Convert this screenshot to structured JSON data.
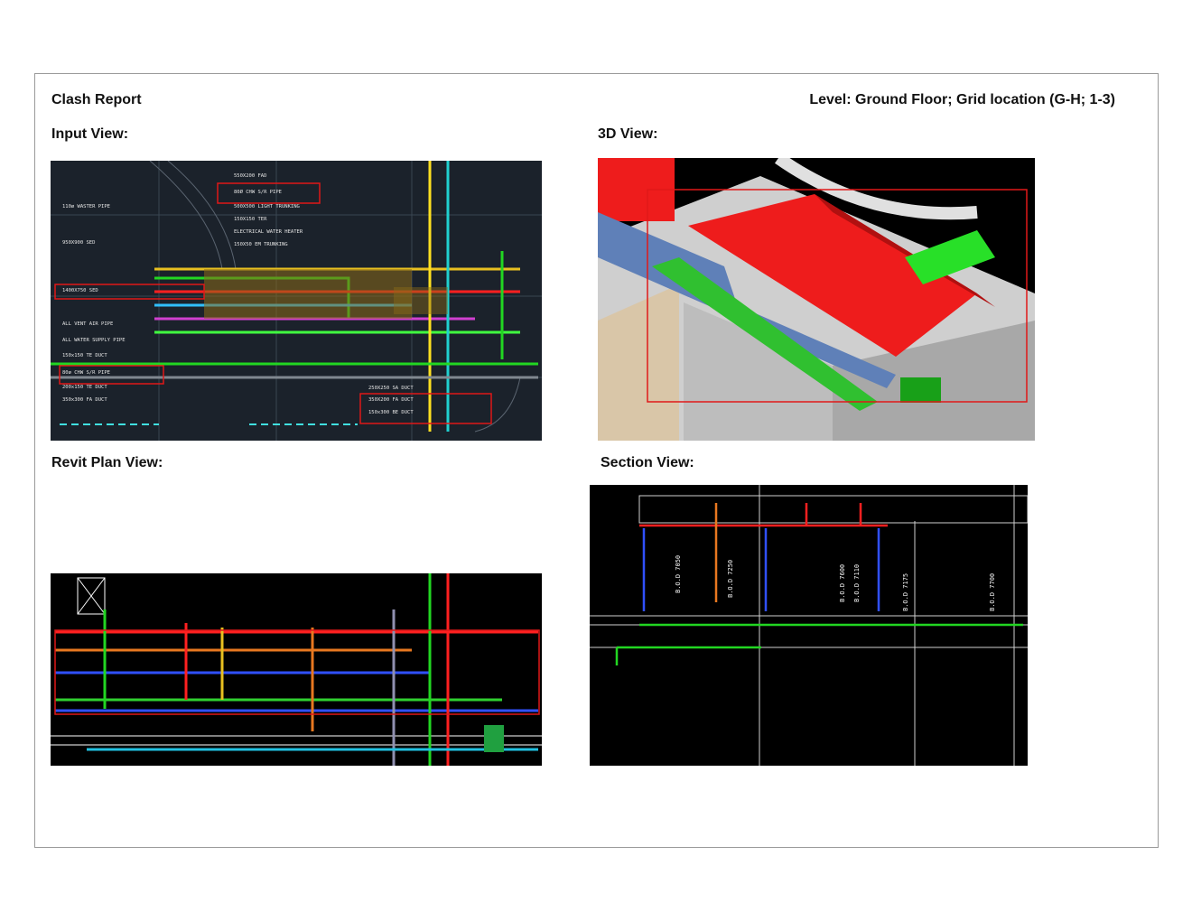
{
  "report": {
    "title": "Clash Report",
    "location": "Level: Ground Floor; Grid location (G-H; 1-3)"
  },
  "views": {
    "input": {
      "label": "Input View:",
      "annotations": [
        "550X200 FAD",
        "80Ø CHW S/R PIPE",
        "500X500 LIGHT TRUNKING",
        "150X150 TER",
        "ELECTRICAL WATER HEATER",
        "150X50 EM TRUNKING",
        "110ø WASTER PIPE",
        "950X900 SED",
        "1400X750 SED",
        "ALL VENT AIR PIPE",
        "ALL WATER SUPPLY PIPE",
        "150x150 TE DUCT",
        "80ø CHW S/R PIPE",
        "200x150 TE DUCT",
        "350x300 FA DUCT",
        "350X200 FA DUCT",
        "150x300 BE DUCT",
        "250X250 SA DUCT"
      ]
    },
    "three_d": {
      "label": "3D View:"
    },
    "revit_plan": {
      "label": "Revit Plan View:"
    },
    "section": {
      "label": "Section View:",
      "levels": [
        "B.O.D 7050",
        "B.O.D 7250",
        "B.O.D 7600",
        "B.O.D 7110",
        "B.O.D 7175",
        "B.O.D 7700"
      ]
    }
  },
  "colors": {
    "cad_background": "#1b222b",
    "section_background": "#000000",
    "clash_box": "#e01818",
    "duct_red": "#ff1414",
    "pipe_green": "#22d622",
    "duct_blue": "#5078b4"
  }
}
